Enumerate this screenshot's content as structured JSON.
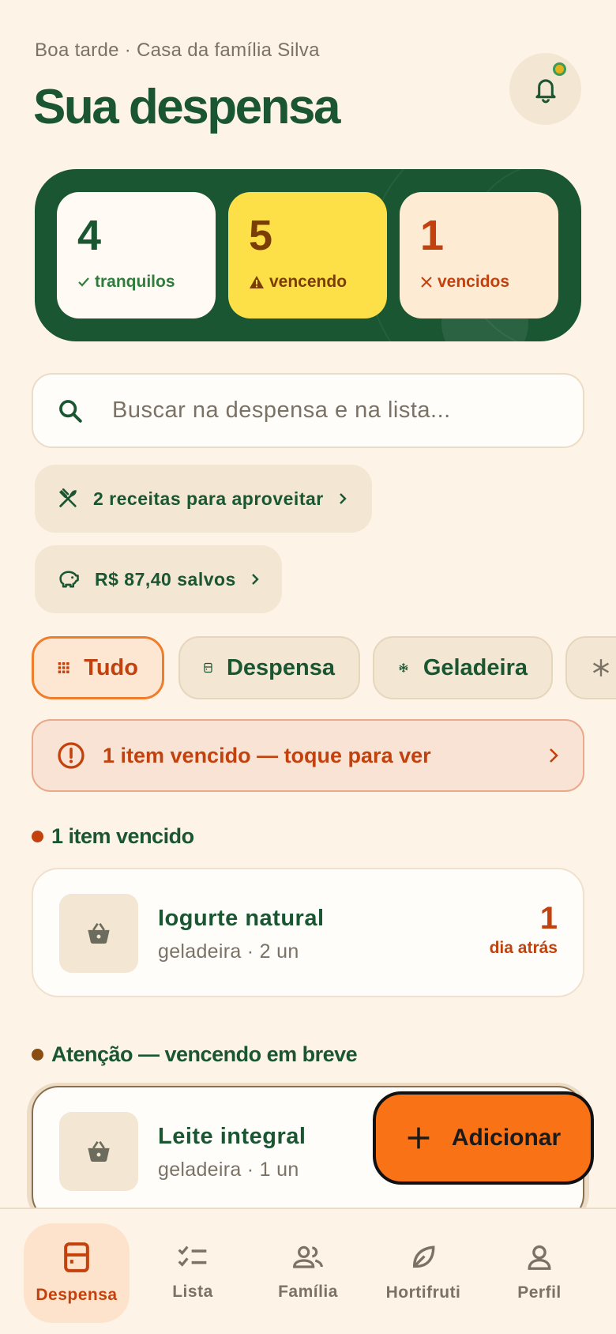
{
  "header": {
    "greeting": "Boa tarde · Casa da família Silva",
    "title": "Sua despensa"
  },
  "stats": [
    {
      "value": "4",
      "label": "tranquilos",
      "icon": "check-icon"
    },
    {
      "value": "5",
      "label": "vencendo",
      "icon": "warning-icon"
    },
    {
      "value": "1",
      "label": "vencidos",
      "icon": "x-icon"
    }
  ],
  "search": {
    "placeholder": "Buscar na despensa e na lista..."
  },
  "pills": {
    "recipes": "2 receitas para aproveitar",
    "saved": "R$ 87,40 salvos"
  },
  "filters": [
    {
      "label": "Tudo",
      "icon": "grid-icon",
      "active": true
    },
    {
      "label": "Despensa",
      "icon": "cabinet-icon"
    },
    {
      "label": "Geladeira",
      "icon": "snowflake-icon"
    },
    {
      "label": "",
      "icon": "snowflake-icon"
    }
  ],
  "alert": {
    "text": "1 item vencido — toque para ver"
  },
  "sections": {
    "expired": "1 item vencido",
    "warning": "Atenção — vencendo em breve"
  },
  "items": [
    {
      "name": "Iogurte natural",
      "meta": "geladeira · 2 un",
      "days": "1",
      "days_label": "dia atrás"
    },
    {
      "name": "Leite integral",
      "meta": "geladeira · 1 un"
    }
  ],
  "fab": {
    "label": "Adicionar"
  },
  "nav": [
    {
      "label": "Despensa",
      "icon": "pantry-icon",
      "active": true
    },
    {
      "label": "Lista",
      "icon": "checklist-icon"
    },
    {
      "label": "Família",
      "icon": "people-icon"
    },
    {
      "label": "Hortifruti",
      "icon": "leaf-icon"
    },
    {
      "label": "Perfil",
      "icon": "user-icon"
    }
  ],
  "colors": {
    "background": "#fdf3e7",
    "primary": "#1a5632",
    "accent": "#f97316",
    "danger": "#c2410c",
    "warning": "#fde047"
  }
}
